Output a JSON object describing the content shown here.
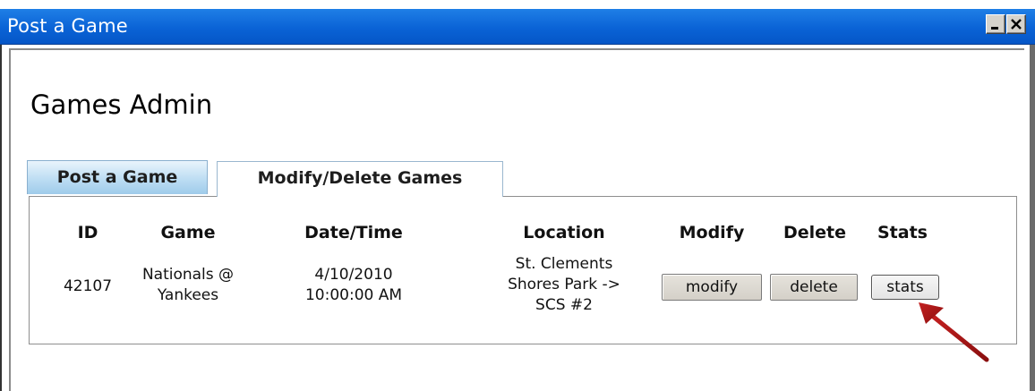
{
  "window": {
    "title": "Post a Game"
  },
  "page": {
    "heading": "Games Admin"
  },
  "tabs": [
    {
      "label": "Post a Game",
      "active": false
    },
    {
      "label": "Modify/Delete Games",
      "active": true
    }
  ],
  "table": {
    "headers": [
      "ID",
      "Game",
      "Date/Time",
      "Location",
      "Modify",
      "Delete",
      "Stats"
    ],
    "rows": [
      {
        "id": "42107",
        "game_line1": "Nationals @",
        "game_line2": "Yankees",
        "date": "4/10/2010",
        "time": "10:00:00 AM",
        "location_line1": "St. Clements",
        "location_line2": "Shores Park ->",
        "location_line3": "SCS #2",
        "modify_label": "modify",
        "delete_label": "delete",
        "stats_label": "stats"
      }
    ]
  },
  "colors": {
    "titlebar": "#0a63d6",
    "arrow": "#b01818"
  }
}
